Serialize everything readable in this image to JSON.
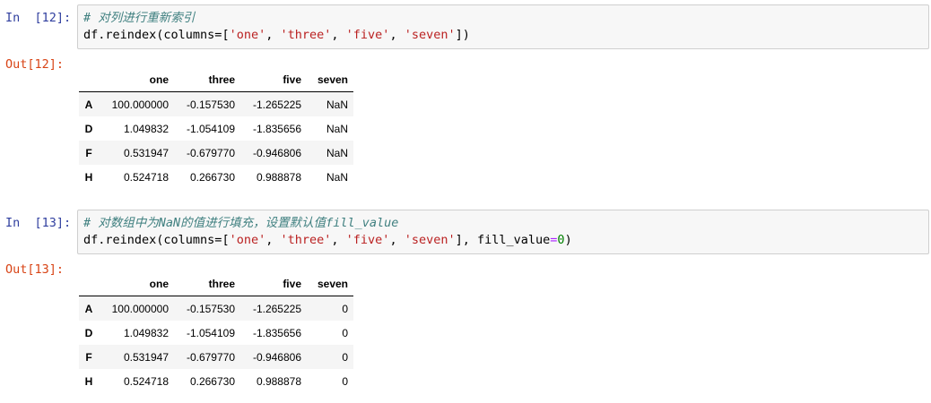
{
  "cells": [
    {
      "in_prompt": "In  [12]:",
      "out_prompt": "Out[12]:",
      "comment": "# 对列进行重新索引",
      "code_prefix": "df.reindex(columns=",
      "code_list": [
        "'one'",
        "'three'",
        "'five'",
        "'seven'"
      ],
      "code_suffix": "])",
      "fill_value_part": "",
      "fill_value_num": "",
      "table": {
        "columns": [
          "",
          "one",
          "three",
          "five",
          "seven"
        ],
        "rows": [
          {
            "index": "A",
            "values": [
              "100.000000",
              "-0.157530",
              "-1.265225",
              "NaN"
            ]
          },
          {
            "index": "D",
            "values": [
              "1.049832",
              "-1.054109",
              "-1.835656",
              "NaN"
            ]
          },
          {
            "index": "F",
            "values": [
              "0.531947",
              "-0.679770",
              "-0.946806",
              "NaN"
            ]
          },
          {
            "index": "H",
            "values": [
              "0.524718",
              "0.266730",
              "0.988878",
              "NaN"
            ]
          }
        ]
      }
    },
    {
      "in_prompt": "In  [13]:",
      "out_prompt": "Out[13]:",
      "comment": "# 对数组中为NaN的值进行填充，设置默认值fill_value",
      "code_prefix": "df.reindex(columns=",
      "code_list": [
        "'one'",
        "'three'",
        "'five'",
        "'seven'"
      ],
      "code_suffix": "], fill_value",
      "fill_value_part": "=",
      "fill_value_num": "0",
      "table": {
        "columns": [
          "",
          "one",
          "three",
          "five",
          "seven"
        ],
        "rows": [
          {
            "index": "A",
            "values": [
              "100.000000",
              "-0.157530",
              "-1.265225",
              "0"
            ]
          },
          {
            "index": "D",
            "values": [
              "1.049832",
              "-1.054109",
              "-1.835656",
              "0"
            ]
          },
          {
            "index": "F",
            "values": [
              "0.531947",
              "-0.679770",
              "-0.946806",
              "0"
            ]
          },
          {
            "index": "H",
            "values": [
              "0.524718",
              "0.266730",
              "0.988878",
              "0"
            ]
          }
        ]
      }
    }
  ]
}
